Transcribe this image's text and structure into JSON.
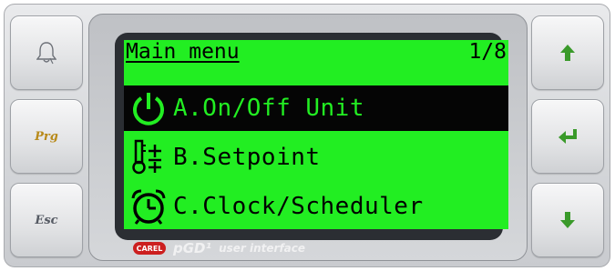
{
  "screen": {
    "title": "Main menu",
    "page": "1/8",
    "lcd_color": "#22ee22",
    "menu_items": [
      {
        "label": "A.On/Off Unit",
        "icon": "power-icon",
        "selected": true
      },
      {
        "label": "B.Setpoint",
        "icon": "thermometer-setpoint-icon",
        "selected": false
      },
      {
        "label": "C.Clock/Scheduler",
        "icon": "alarm-clock-icon",
        "selected": false
      }
    ]
  },
  "keys": {
    "left": [
      {
        "icon": "bell-icon"
      },
      {
        "label": "Prg"
      },
      {
        "label": "Esc"
      }
    ],
    "right": [
      {
        "icon": "up-arrow-icon"
      },
      {
        "icon": "enter-icon"
      },
      {
        "icon": "down-arrow-icon"
      }
    ],
    "arrow_color": "#3a9a2a"
  },
  "brand": {
    "logo": "CAREL",
    "product": "pGD¹",
    "tagline": "user interface"
  }
}
